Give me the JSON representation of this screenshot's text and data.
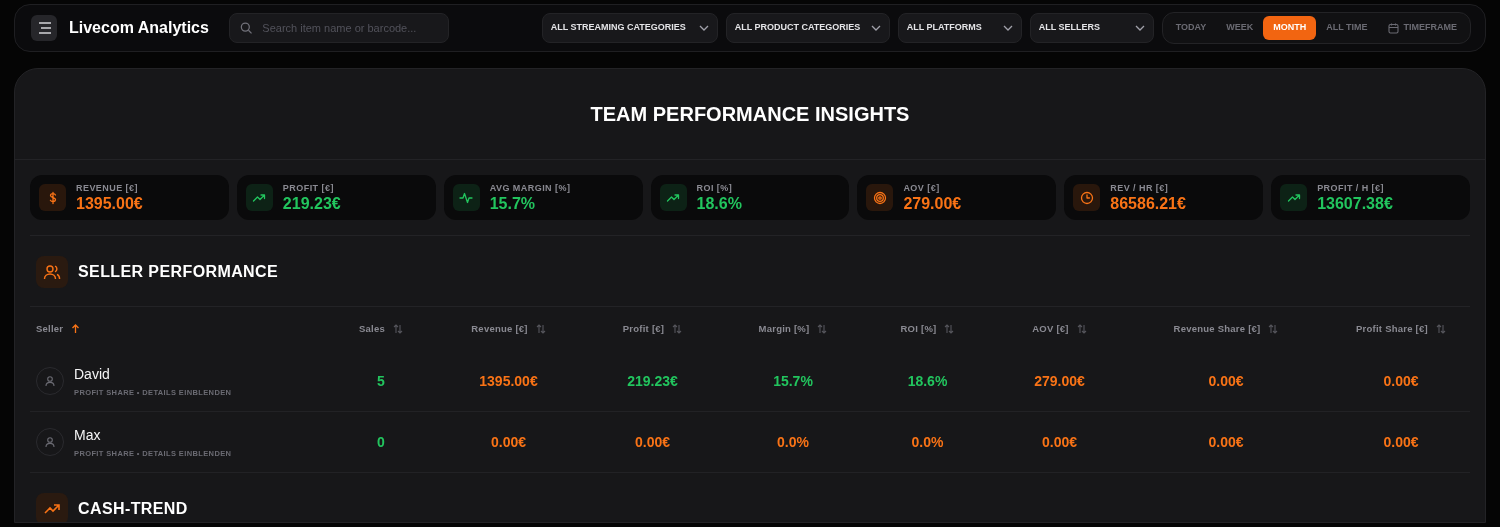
{
  "app": {
    "title": "Livecom Analytics"
  },
  "search": {
    "placeholder": "Search item name or barcode..."
  },
  "filters": [
    {
      "label": "ALL STREAMING CATEGORIES"
    },
    {
      "label": "ALL PRODUCT CATEGORIES"
    },
    {
      "label": "ALL PLATFORMS"
    },
    {
      "label": "ALL SELLERS"
    }
  ],
  "periods": [
    {
      "label": "TODAY",
      "selected": false
    },
    {
      "label": "WEEK",
      "selected": false
    },
    {
      "label": "MONTH",
      "selected": true
    },
    {
      "label": "ALL TIME",
      "selected": false
    },
    {
      "label": "TIMEFRAME",
      "selected": false,
      "kind": "calendar"
    }
  ],
  "page_title": "TEAM PERFORMANCE INSIGHTS",
  "kpis": [
    {
      "label": "REVENUE [€]",
      "value": "1395.00€",
      "color": "#f97316",
      "kind": "dollar"
    },
    {
      "label": "PROFIT [€]",
      "value": "219.23€",
      "color": "#22c55e",
      "kind": "trend"
    },
    {
      "label": "AVG MARGIN [%]",
      "value": "15.7%",
      "color": "#22c55e",
      "kind": "pulse"
    },
    {
      "label": "ROI [%]",
      "value": "18.6%",
      "color": "#22c55e",
      "kind": "trend"
    },
    {
      "label": "AOV [€]",
      "value": "279.00€",
      "color": "#f97316",
      "kind": "target"
    },
    {
      "label": "REV / HR [€]",
      "value": "86586.21€",
      "color": "#f97316",
      "kind": "clock"
    },
    {
      "label": "PROFIT / H [€]",
      "value": "13607.38€",
      "color": "#22c55e",
      "kind": "trend"
    }
  ],
  "seller_section": {
    "title": "SELLER PERFORMANCE"
  },
  "table": {
    "columns": [
      {
        "label": "Seller",
        "sorted": true
      },
      {
        "label": "Sales",
        "sorted": false
      },
      {
        "label": "Revenue [€]",
        "sorted": false
      },
      {
        "label": "Profit [€]",
        "sorted": false
      },
      {
        "label": "Margin [%]",
        "sorted": false
      },
      {
        "label": "ROI [%]",
        "sorted": false
      },
      {
        "label": "AOV [€]",
        "sorted": false
      },
      {
        "label": "Revenue Share [€]",
        "sorted": false
      },
      {
        "label": "Profit Share [€]",
        "sorted": false
      }
    ],
    "rows": [
      {
        "cells": [
          {
            "text": "David",
            "subtitle": "PROFIT SHARE • DETAILS EINBLENDEN"
          },
          {
            "text": "5",
            "color": "#22c55e"
          },
          {
            "text": "1395.00€",
            "color": "#f97316"
          },
          {
            "text": "219.23€",
            "color": "#22c55e"
          },
          {
            "text": "15.7%",
            "color": "#22c55e"
          },
          {
            "text": "18.6%",
            "color": "#22c55e"
          },
          {
            "text": "279.00€",
            "color": "#f97316"
          },
          {
            "text": "0.00€",
            "color": "#f97316"
          },
          {
            "text": "0.00€",
            "color": "#f97316"
          }
        ]
      },
      {
        "cells": [
          {
            "text": "Max",
            "subtitle": "PROFIT SHARE • DETAILS EINBLENDEN"
          },
          {
            "text": "0",
            "color": "#22c55e"
          },
          {
            "text": "0.00€",
            "color": "#f97316"
          },
          {
            "text": "0.00€",
            "color": "#f97316"
          },
          {
            "text": "0.0%",
            "color": "#f97316"
          },
          {
            "text": "0.0%",
            "color": "#f97316"
          },
          {
            "text": "0.00€",
            "color": "#f97316"
          },
          {
            "text": "0.00€",
            "color": "#f97316"
          },
          {
            "text": "0.00€",
            "color": "#f97316"
          }
        ]
      }
    ]
  },
  "trend_section": {
    "title": "CASH-TREND"
  }
}
